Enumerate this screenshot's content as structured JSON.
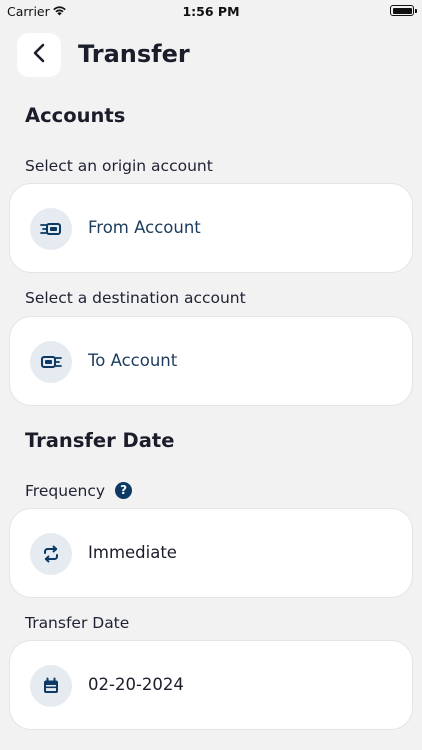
{
  "status_bar": {
    "carrier": "Carrier",
    "time": "1:56 PM"
  },
  "header": {
    "title": "Transfer"
  },
  "accounts_section": {
    "title": "Accounts",
    "origin": {
      "label": "Select an origin account",
      "placeholder": "From Account",
      "icon": "money-out-icon"
    },
    "destination": {
      "label": "Select a destination account",
      "placeholder": "To Account",
      "icon": "money-in-icon"
    }
  },
  "date_section": {
    "title": "Transfer Date",
    "frequency": {
      "label": "Frequency",
      "value": "Immediate",
      "icon": "repeat-icon",
      "help_icon": "help-icon"
    },
    "date": {
      "label": "Transfer Date",
      "value": "02-20-2024",
      "icon": "calendar-icon"
    }
  },
  "colors": {
    "accent": "#0c3a64",
    "background": "#f2f2f2",
    "card": "#ffffff",
    "icon_bg": "#e6ebf1"
  }
}
